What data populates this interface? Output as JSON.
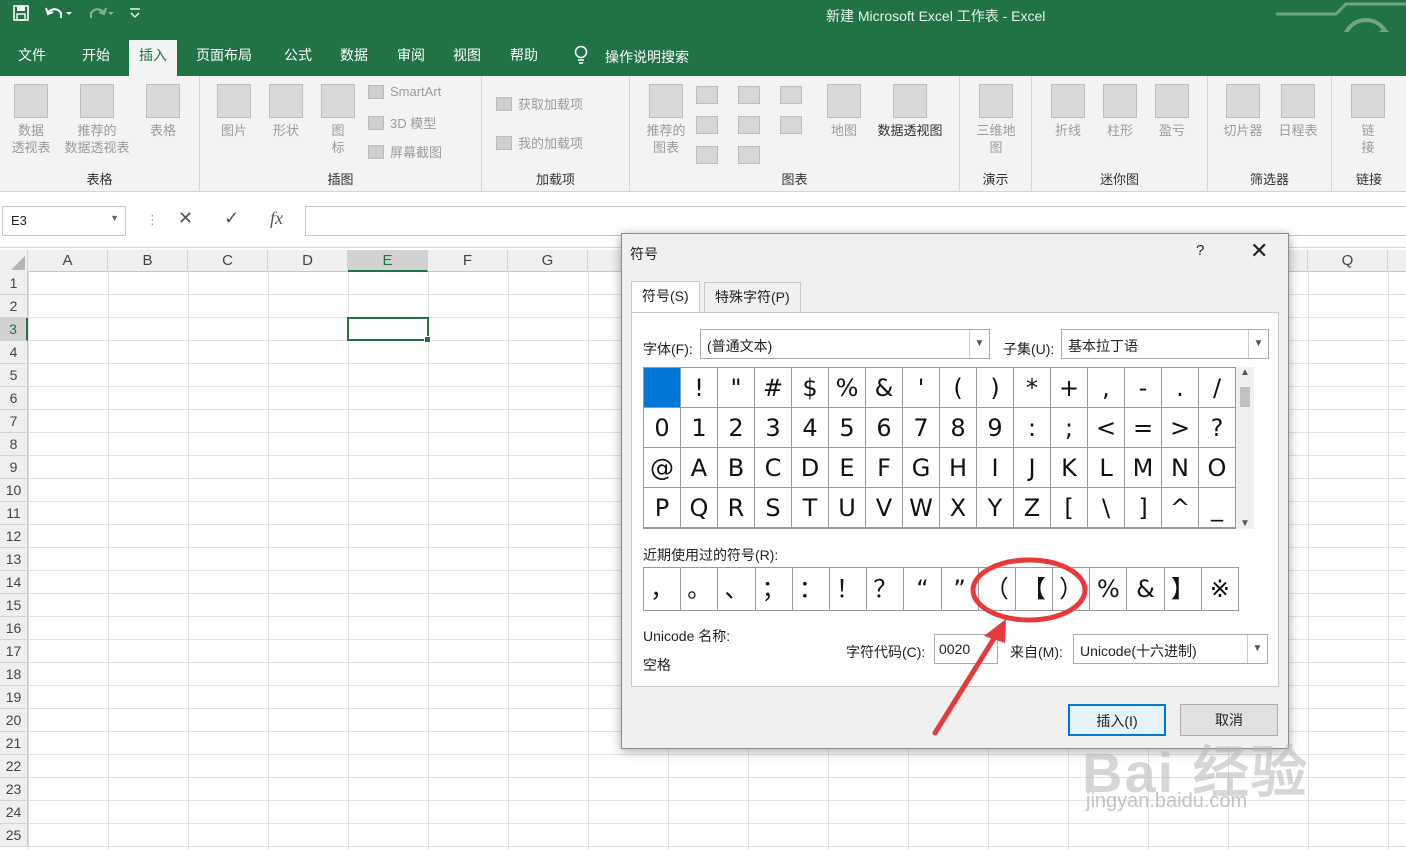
{
  "window": {
    "title": "新建 Microsoft Excel 工作表  -  Excel"
  },
  "tabs": [
    {
      "label": "文件"
    },
    {
      "label": "开始"
    },
    {
      "label": "插入"
    },
    {
      "label": "页面布局"
    },
    {
      "label": "公式"
    },
    {
      "label": "数据"
    },
    {
      "label": "审阅"
    },
    {
      "label": "视图"
    },
    {
      "label": "帮助"
    }
  ],
  "search": {
    "label": "操作说明搜索"
  },
  "ribbon": {
    "tables": {
      "group": "表格",
      "pivot": "数据\n透视表",
      "recommended_pivot": "推荐的\n数据透视表",
      "table": "表格"
    },
    "illustrations": {
      "group": "插图",
      "pictures": "图片",
      "shapes": "形状",
      "icons": "图\n标",
      "smartart": "SmartArt",
      "model3d": "3D 模型",
      "screenshot": "屏幕截图"
    },
    "addins": {
      "group": "加载项",
      "get": "获取加载项",
      "my": "我的加载项"
    },
    "charts": {
      "group": "图表",
      "recommended": "推荐的\n图表",
      "maps": "地图",
      "pivot_chart": "数据透视图"
    },
    "tours": {
      "group": "演示",
      "map3d": "三维地\n图"
    },
    "sparklines": {
      "group": "迷你图",
      "line": "折线",
      "column": "柱形",
      "winloss": "盈亏"
    },
    "filters": {
      "group": "筛选器",
      "slicer": "切片器",
      "timeline": "日程表"
    },
    "links": {
      "group": "链接",
      "link": "链\n接"
    }
  },
  "formula_bar": {
    "name_box": "E3",
    "fx": "fx",
    "cancel": "✕",
    "enter": "✓"
  },
  "grid": {
    "columns": [
      "A",
      "B",
      "C",
      "D",
      "E",
      "F",
      "G",
      "",
      "",
      "",
      "",
      "",
      "",
      "",
      "",
      "",
      "Q"
    ],
    "rows": [
      "1",
      "2",
      "3",
      "4",
      "5",
      "6",
      "7",
      "8",
      "9",
      "10",
      "11",
      "12",
      "13",
      "14",
      "15",
      "16",
      "17",
      "18",
      "19",
      "20",
      "21",
      "22",
      "23",
      "24",
      "25"
    ],
    "active_cell": "E3"
  },
  "dialog": {
    "title": "符号",
    "help": "?",
    "close": "✕",
    "tab_symbols": "符号(S)",
    "tab_special": "特殊字符(P)",
    "font_label": "字体(F):",
    "font_value": "(普通文本)",
    "subset_label": "子集(U):",
    "subset_value": "基本拉丁语",
    "symbols": [
      " ",
      "!",
      "\"",
      "#",
      "$",
      "%",
      "&",
      "'",
      "(",
      ")",
      "*",
      "+",
      ",",
      "-",
      ".",
      "/",
      "0",
      "1",
      "2",
      "3",
      "4",
      "5",
      "6",
      "7",
      "8",
      "9",
      ":",
      ";",
      "<",
      "=",
      ">",
      "?",
      "@",
      "A",
      "B",
      "C",
      "D",
      "E",
      "F",
      "G",
      "H",
      "I",
      "J",
      "K",
      "L",
      "M",
      "N",
      "O",
      "P",
      "Q",
      "R",
      "S",
      "T",
      "U",
      "V",
      "W",
      "X",
      "Y",
      "Z",
      "[",
      "\\",
      "]",
      "^",
      "_"
    ],
    "recent_label": "近期使用过的符号(R):",
    "recent": [
      "，",
      "。",
      "、",
      "；",
      "：",
      "！",
      "？",
      "“",
      "”",
      "（",
      "【",
      "）",
      "%",
      "&",
      "】",
      "※"
    ],
    "unicode_name_label": "Unicode 名称:",
    "unicode_name_value": "空格",
    "char_code_label": "字符代码(C):",
    "char_code_value": "0020",
    "from_label": "来自(M):",
    "from_value": "Unicode(十六进制)",
    "insert_button": "插入(I)",
    "cancel_button": "取消"
  },
  "watermark": {
    "brand": "Bai 经验",
    "url": "jingyan.baidu.com"
  },
  "colors": {
    "accent": "#217346",
    "annotation": "#e83a3a",
    "selection": "#0078d7"
  }
}
